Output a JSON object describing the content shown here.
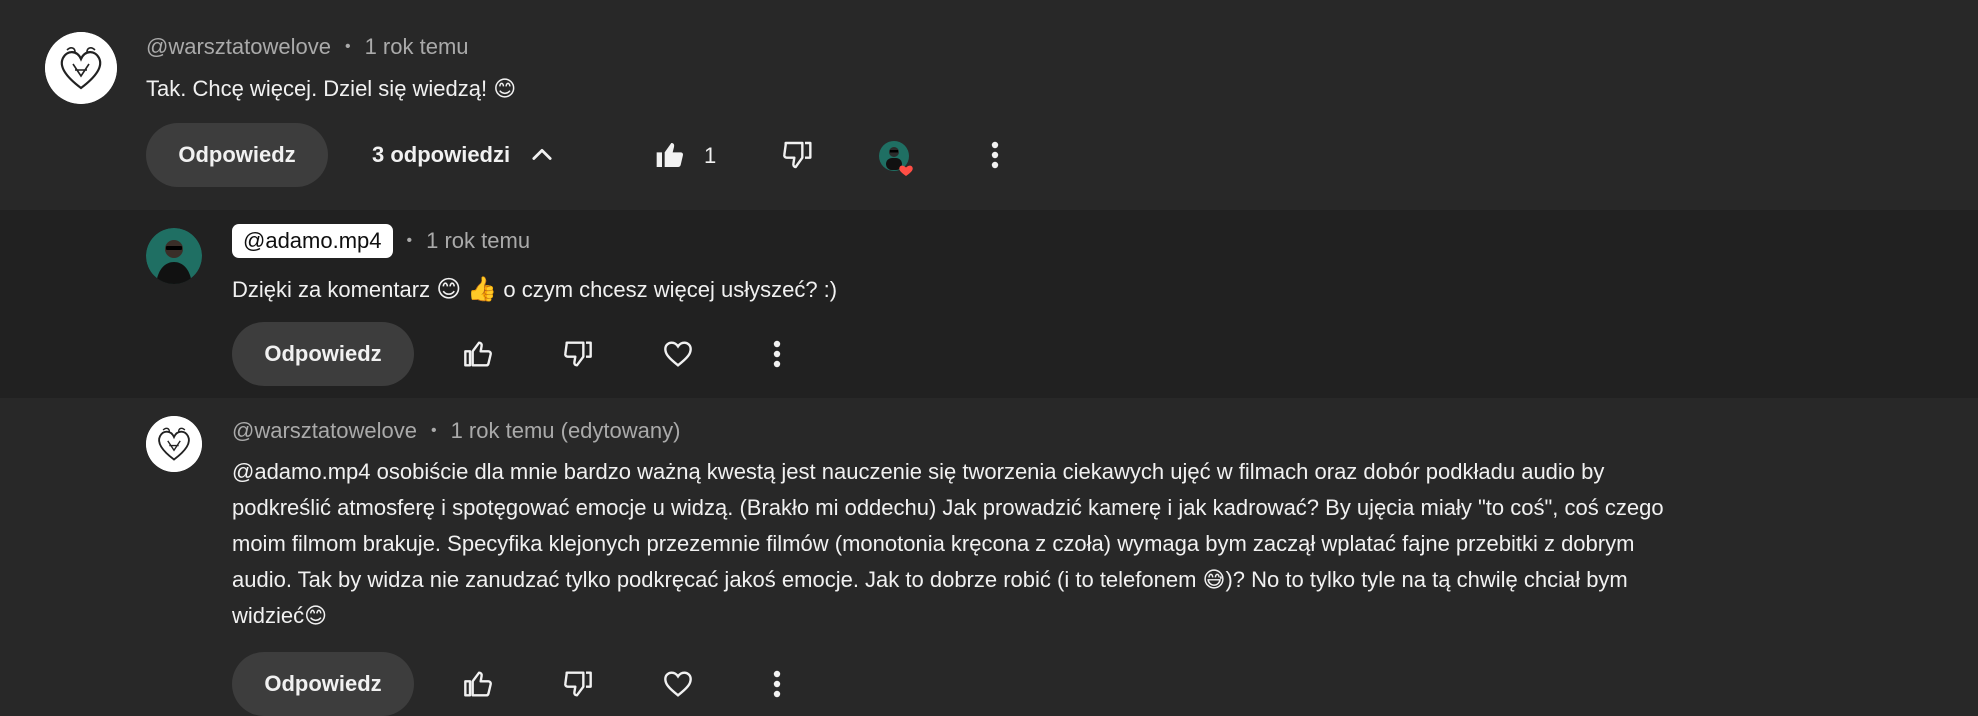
{
  "top_comment": {
    "handle": "@warsztatowelove",
    "time": "1 rok temu",
    "text": "Tak. Chcę więcej. Dziel się wiedzą! 😊",
    "reply_label": "Odpowiedz",
    "replies_label": "3 odpowiedzi",
    "like_count": "1"
  },
  "reply_1": {
    "handle": "@adamo.mp4",
    "time": "1 rok temu",
    "text_parts": [
      "Dzięki za komentarz ",
      "😊",
      " ",
      "👍",
      " o czym chcesz więcej usłyszeć? :)"
    ],
    "reply_label": "Odpowiedz"
  },
  "reply_2": {
    "handle": "@warsztatowelove",
    "time": "1 rok temu (edytowany)",
    "lines": [
      "@adamo.mp4 osobiście dla mnie bardzo ważną kwestą jest nauczenie się tworzenia ciekawych ujęć w filmach oraz dobór podkładu audio by",
      "podkreślić atmosferę i spotęgować emocje u widzą.  (Brakło mi oddechu) Jak prowadzić kamerę i jak kadrować? By ujęcia miały \"to coś\", coś czego",
      "moim filmom brakuje. Specyfika klejonych przezemnie filmów (monotonia kręcona z czoła) wymaga bym zaczął wplatać fajne przebitki z dobrym",
      "audio. Tak by widza nie zanudzać tylko podkręcać jakoś emocje. Jak to dobrze robić (i to telefonem 😅)? No to tylko tyle na tą chwilę chciał bym",
      "widzieć😊"
    ],
    "reply_label": "Odpowiedz"
  },
  "icons": {
    "like": "thumbs-up-icon",
    "dislike": "thumbs-down-icon",
    "heart": "heart-icon",
    "more": "more-vertical-icon",
    "expand": "chevron-up-icon"
  },
  "colors": {
    "background": "#282828",
    "highlight_background": "#212121",
    "text": "#f1f1f1",
    "meta": "#aaaaaa",
    "button": "#3d3d3d",
    "heart_badge": "#ff4e45"
  }
}
